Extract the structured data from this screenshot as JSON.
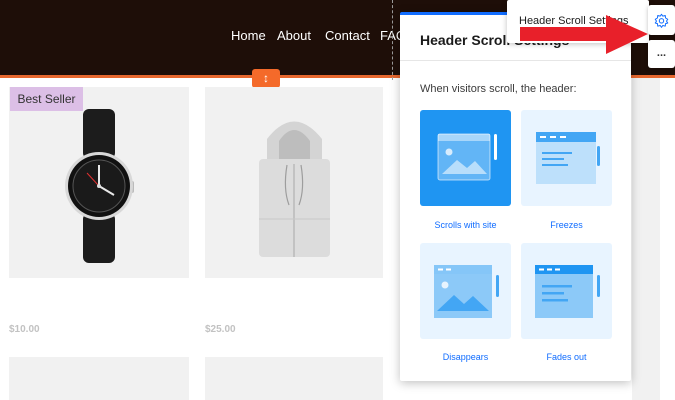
{
  "header": {
    "nav": [
      "Home",
      "About",
      "Contact",
      "FAQ"
    ],
    "resize_glyph": "↕"
  },
  "products": [
    {
      "badge": "Best Seller",
      "price": "$10.00",
      "image": "watch"
    },
    {
      "badge": "",
      "price": "$25.00",
      "image": "hoodie"
    }
  ],
  "panel": {
    "title": "Header Scroll Settings",
    "description": "When visitors scroll, the header:",
    "options": [
      {
        "label": "Scrolls with site",
        "selected": true
      },
      {
        "label": "Freezes",
        "selected": false
      },
      {
        "label": "Disappears",
        "selected": false
      },
      {
        "label": "Fades out",
        "selected": false
      }
    ]
  },
  "context_menu": {
    "label": "Header Scroll Settings"
  },
  "side_buttons": {
    "settings_icon": "gear-icon",
    "more_label": "..."
  },
  "colors": {
    "header_bg": "#1e0e08",
    "accent_orange": "#e7672e",
    "accent_blue": "#116dff",
    "selected_option": "#1f95f2",
    "option_bg": "#e8f4ff",
    "badge_bg": "#dcbfe6",
    "arrow_red": "#e8202a"
  }
}
